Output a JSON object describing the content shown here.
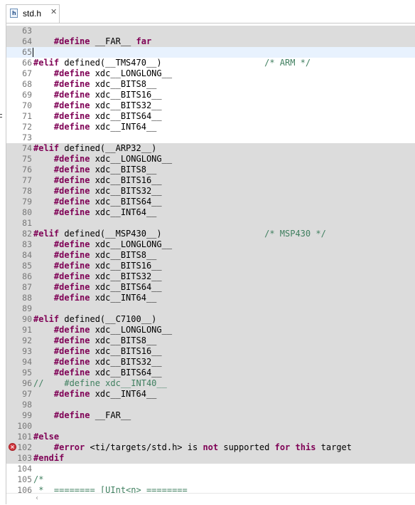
{
  "tab": {
    "title": "std.h",
    "close": "✕"
  },
  "lines": [
    {
      "n": "63",
      "hl": true,
      "segs": [
        {
          "t": "",
          "c": "p"
        }
      ]
    },
    {
      "n": "64",
      "hl": true,
      "segs": [
        {
          "t": "    ",
          "c": "p"
        },
        {
          "t": "#define",
          "c": "kw"
        },
        {
          "t": " __FAR__ ",
          "c": "p"
        },
        {
          "t": "far",
          "c": "kw"
        }
      ]
    },
    {
      "n": "65",
      "cur": true,
      "segs": []
    },
    {
      "n": "66",
      "segs": [
        {
          "t": "#elif",
          "c": "kw"
        },
        {
          "t": " defined(__TMS470__)                    ",
          "c": "p"
        },
        {
          "t": "/* ARM */",
          "c": "cm"
        }
      ]
    },
    {
      "n": "67",
      "segs": [
        {
          "t": "    ",
          "c": "p"
        },
        {
          "t": "#define",
          "c": "kw"
        },
        {
          "t": " xdc__LONGLONG__",
          "c": "p"
        }
      ]
    },
    {
      "n": "68",
      "segs": [
        {
          "t": "    ",
          "c": "p"
        },
        {
          "t": "#define",
          "c": "kw"
        },
        {
          "t": " xdc__BITS8__",
          "c": "p"
        }
      ]
    },
    {
      "n": "69",
      "segs": [
        {
          "t": "    ",
          "c": "p"
        },
        {
          "t": "#define",
          "c": "kw"
        },
        {
          "t": " xdc__BITS16__",
          "c": "p"
        }
      ]
    },
    {
      "n": "70",
      "segs": [
        {
          "t": "    ",
          "c": "p"
        },
        {
          "t": "#define",
          "c": "kw"
        },
        {
          "t": " xdc__BITS32__",
          "c": "p"
        }
      ]
    },
    {
      "n": "71",
      "segs": [
        {
          "t": "    ",
          "c": "p"
        },
        {
          "t": "#define",
          "c": "kw"
        },
        {
          "t": " xdc__BITS64__",
          "c": "p"
        }
      ]
    },
    {
      "n": "72",
      "segs": [
        {
          "t": "    ",
          "c": "p"
        },
        {
          "t": "#define",
          "c": "kw"
        },
        {
          "t": " xdc__INT64__",
          "c": "p"
        }
      ]
    },
    {
      "n": "73",
      "segs": []
    },
    {
      "n": "74",
      "hl": true,
      "segs": [
        {
          "t": "#elif",
          "c": "kw"
        },
        {
          "t": " defined(__ARP32__)",
          "c": "p"
        }
      ]
    },
    {
      "n": "75",
      "hl": true,
      "segs": [
        {
          "t": "    ",
          "c": "p"
        },
        {
          "t": "#define",
          "c": "kw"
        },
        {
          "t": " xdc__LONGLONG__",
          "c": "p"
        }
      ]
    },
    {
      "n": "76",
      "hl": true,
      "segs": [
        {
          "t": "    ",
          "c": "p"
        },
        {
          "t": "#define",
          "c": "kw"
        },
        {
          "t": " xdc__BITS8__",
          "c": "p"
        }
      ]
    },
    {
      "n": "77",
      "hl": true,
      "segs": [
        {
          "t": "    ",
          "c": "p"
        },
        {
          "t": "#define",
          "c": "kw"
        },
        {
          "t": " xdc__BITS16__",
          "c": "p"
        }
      ]
    },
    {
      "n": "78",
      "hl": true,
      "segs": [
        {
          "t": "    ",
          "c": "p"
        },
        {
          "t": "#define",
          "c": "kw"
        },
        {
          "t": " xdc__BITS32__",
          "c": "p"
        }
      ]
    },
    {
      "n": "79",
      "hl": true,
      "segs": [
        {
          "t": "    ",
          "c": "p"
        },
        {
          "t": "#define",
          "c": "kw"
        },
        {
          "t": " xdc__BITS64__",
          "c": "p"
        }
      ]
    },
    {
      "n": "80",
      "hl": true,
      "segs": [
        {
          "t": "    ",
          "c": "p"
        },
        {
          "t": "#define",
          "c": "kw"
        },
        {
          "t": " xdc__INT64__",
          "c": "p"
        }
      ]
    },
    {
      "n": "81",
      "hl": true,
      "segs": []
    },
    {
      "n": "82",
      "hl": true,
      "segs": [
        {
          "t": "#elif",
          "c": "kw"
        },
        {
          "t": " defined(__MSP430__)                    ",
          "c": "p"
        },
        {
          "t": "/* MSP430 */",
          "c": "cm"
        }
      ]
    },
    {
      "n": "83",
      "hl": true,
      "segs": [
        {
          "t": "    ",
          "c": "p"
        },
        {
          "t": "#define",
          "c": "kw"
        },
        {
          "t": " xdc__LONGLONG__",
          "c": "p"
        }
      ]
    },
    {
      "n": "84",
      "hl": true,
      "segs": [
        {
          "t": "    ",
          "c": "p"
        },
        {
          "t": "#define",
          "c": "kw"
        },
        {
          "t": " xdc__BITS8__",
          "c": "p"
        }
      ]
    },
    {
      "n": "85",
      "hl": true,
      "segs": [
        {
          "t": "    ",
          "c": "p"
        },
        {
          "t": "#define",
          "c": "kw"
        },
        {
          "t": " xdc__BITS16__",
          "c": "p"
        }
      ]
    },
    {
      "n": "86",
      "hl": true,
      "segs": [
        {
          "t": "    ",
          "c": "p"
        },
        {
          "t": "#define",
          "c": "kw"
        },
        {
          "t": " xdc__BITS32__",
          "c": "p"
        }
      ]
    },
    {
      "n": "87",
      "hl": true,
      "segs": [
        {
          "t": "    ",
          "c": "p"
        },
        {
          "t": "#define",
          "c": "kw"
        },
        {
          "t": " xdc__BITS64__",
          "c": "p"
        }
      ]
    },
    {
      "n": "88",
      "hl": true,
      "segs": [
        {
          "t": "    ",
          "c": "p"
        },
        {
          "t": "#define",
          "c": "kw"
        },
        {
          "t": " xdc__INT64__",
          "c": "p"
        }
      ]
    },
    {
      "n": "89",
      "hl": true,
      "segs": []
    },
    {
      "n": "90",
      "hl": true,
      "segs": [
        {
          "t": "#elif",
          "c": "kw"
        },
        {
          "t": " defined(__C7100__)",
          "c": "p"
        }
      ]
    },
    {
      "n": "91",
      "hl": true,
      "segs": [
        {
          "t": "    ",
          "c": "p"
        },
        {
          "t": "#define",
          "c": "kw"
        },
        {
          "t": " xdc__LONGLONG__",
          "c": "p"
        }
      ]
    },
    {
      "n": "92",
      "hl": true,
      "segs": [
        {
          "t": "    ",
          "c": "p"
        },
        {
          "t": "#define",
          "c": "kw"
        },
        {
          "t": " xdc__BITS8__",
          "c": "p"
        }
      ]
    },
    {
      "n": "93",
      "hl": true,
      "segs": [
        {
          "t": "    ",
          "c": "p"
        },
        {
          "t": "#define",
          "c": "kw"
        },
        {
          "t": " xdc__BITS16__",
          "c": "p"
        }
      ]
    },
    {
      "n": "94",
      "hl": true,
      "segs": [
        {
          "t": "    ",
          "c": "p"
        },
        {
          "t": "#define",
          "c": "kw"
        },
        {
          "t": " xdc__BITS32__",
          "c": "p"
        }
      ]
    },
    {
      "n": "95",
      "hl": true,
      "segs": [
        {
          "t": "    ",
          "c": "p"
        },
        {
          "t": "#define",
          "c": "kw"
        },
        {
          "t": " xdc__BITS64__",
          "c": "p"
        }
      ]
    },
    {
      "n": "96",
      "hl": true,
      "segs": [
        {
          "t": "//    #define xdc__INT40__",
          "c": "cm"
        }
      ]
    },
    {
      "n": "97",
      "hl": true,
      "segs": [
        {
          "t": "    ",
          "c": "p"
        },
        {
          "t": "#define",
          "c": "kw"
        },
        {
          "t": " xdc__INT64__",
          "c": "p"
        }
      ]
    },
    {
      "n": "98",
      "hl": true,
      "segs": []
    },
    {
      "n": "99",
      "hl": true,
      "segs": [
        {
          "t": "    ",
          "c": "p"
        },
        {
          "t": "#define",
          "c": "kw"
        },
        {
          "t": " __FAR__",
          "c": "p"
        }
      ]
    },
    {
      "n": "100",
      "hl": true,
      "segs": []
    },
    {
      "n": "101",
      "hl": true,
      "segs": [
        {
          "t": "#else",
          "c": "kw"
        }
      ]
    },
    {
      "n": "102",
      "hl": true,
      "error": true,
      "segs": [
        {
          "t": "    ",
          "c": "p"
        },
        {
          "t": "#error",
          "c": "kw"
        },
        {
          "t": " <ti/targets/std.h> is ",
          "c": "p"
        },
        {
          "t": "not",
          "c": "kw"
        },
        {
          "t": " supported ",
          "c": "p"
        },
        {
          "t": "for",
          "c": "kw"
        },
        {
          "t": " ",
          "c": "p"
        },
        {
          "t": "this",
          "c": "kw"
        },
        {
          "t": " target",
          "c": "p"
        }
      ]
    },
    {
      "n": "103",
      "hl": true,
      "segs": [
        {
          "t": "#endif",
          "c": "kw"
        }
      ]
    },
    {
      "n": "104",
      "segs": []
    },
    {
      "n": "105",
      "segs": [
        {
          "t": "/*",
          "c": "cm"
        }
      ]
    },
    {
      "n": "106",
      "segs": [
        {
          "t": " *  ======== [UInt<n> ========",
          "c": "cm"
        }
      ]
    }
  ],
  "colors": {
    "keyword": "#7f0055",
    "comment": "#3f7f5f",
    "disabled_bg": "#dcdcdc",
    "current_line": "#e8f2fe"
  },
  "icons": {
    "file": "header-file-icon",
    "error": "error-marker-icon"
  }
}
